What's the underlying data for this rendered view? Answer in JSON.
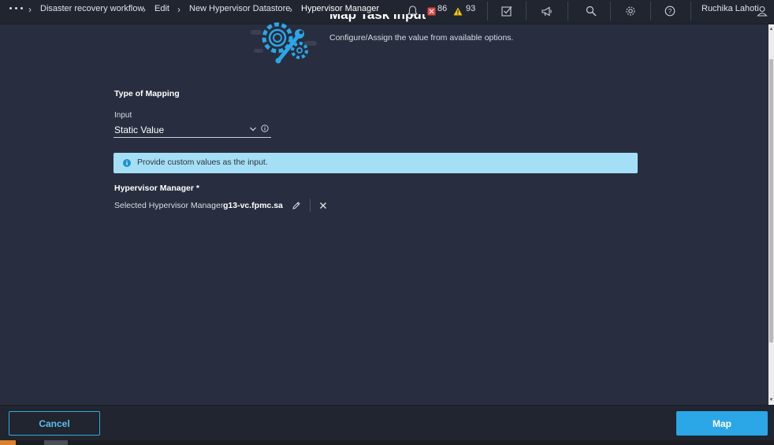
{
  "breadcrumbs": [
    {
      "label": "Disaster recovery workflow"
    },
    {
      "label": "Edit"
    },
    {
      "label": "New Hypervisor Datastore"
    },
    {
      "label": "Hypervisor Manager"
    }
  ],
  "header": {
    "critical_count": "86",
    "warning_count": "93",
    "user_name": "Ruchika Lahoti",
    "colors": {
      "critical": "#e84545",
      "warning": "#f5c518"
    }
  },
  "page": {
    "title": "Map Task Input",
    "subtitle": "Configure/Assign the value from available options."
  },
  "mapping": {
    "section_label": "Type of Mapping",
    "input_label": "Input",
    "input_value": "Static Value"
  },
  "banner": {
    "text": "Provide custom values as the input.",
    "color": "#a5dff6"
  },
  "hypervisor": {
    "label": "Hypervisor Manager *",
    "selected_label": "Selected Hypervisor Manager",
    "selected_value": "g13-vc.fpmc.sa"
  },
  "footer": {
    "cancel_label": "Cancel",
    "map_label": "Map",
    "accent": "#2ba6e6"
  }
}
